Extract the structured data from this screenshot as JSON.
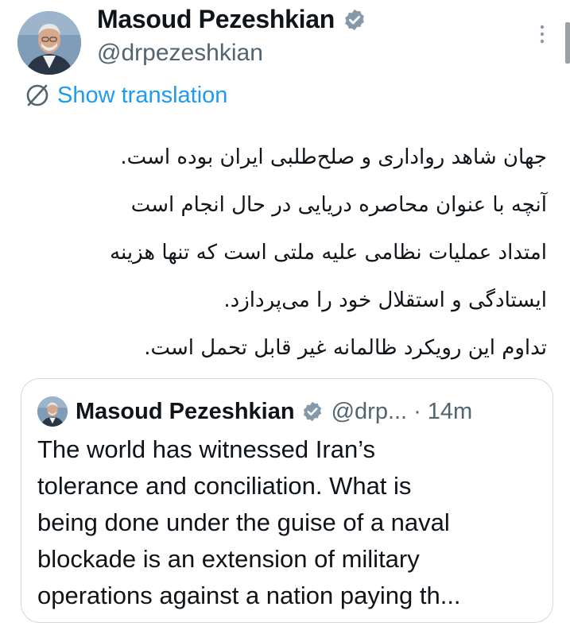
{
  "author": {
    "display_name": "Masoud Pezeshkian",
    "handle": "@drpezeshkian",
    "verified_icon": "verified-badge-icon",
    "avatar": "profile-photo"
  },
  "actions": {
    "more_icon": "more-vertical-icon",
    "translate_icon": "globe-icon",
    "show_translation": "Show translation"
  },
  "tweet": {
    "lines": [
      "جهان شاهد رواداری و صلح‌طلبی ایران بوده است.",
      "آنچه با عنوان محاصره دریایی در حال انجام است",
      "امتداد عملیات نظامی علیه ملتی است که تنها هزینه",
      "ایستادگی و استقلال خود را می‌پردازد.",
      "تداوم این رویکرد ظالمانه غیر قابل تحمل است."
    ]
  },
  "quoted_tweet": {
    "display_name": "Masoud Pezeshkian",
    "handle": "@drp...",
    "separator": "·",
    "time": "14m",
    "lines": [
      "The world has witnessed Iran’s",
      "tolerance and conciliation. What is",
      "being done under the guise of a naval",
      "blockade is an extension of military",
      "operations against a nation paying th..."
    ]
  },
  "colors": {
    "accent": "#1d9bf0",
    "secondary_text": "#536471",
    "border": "#cfd9de",
    "verified_badge": "#829aab"
  }
}
